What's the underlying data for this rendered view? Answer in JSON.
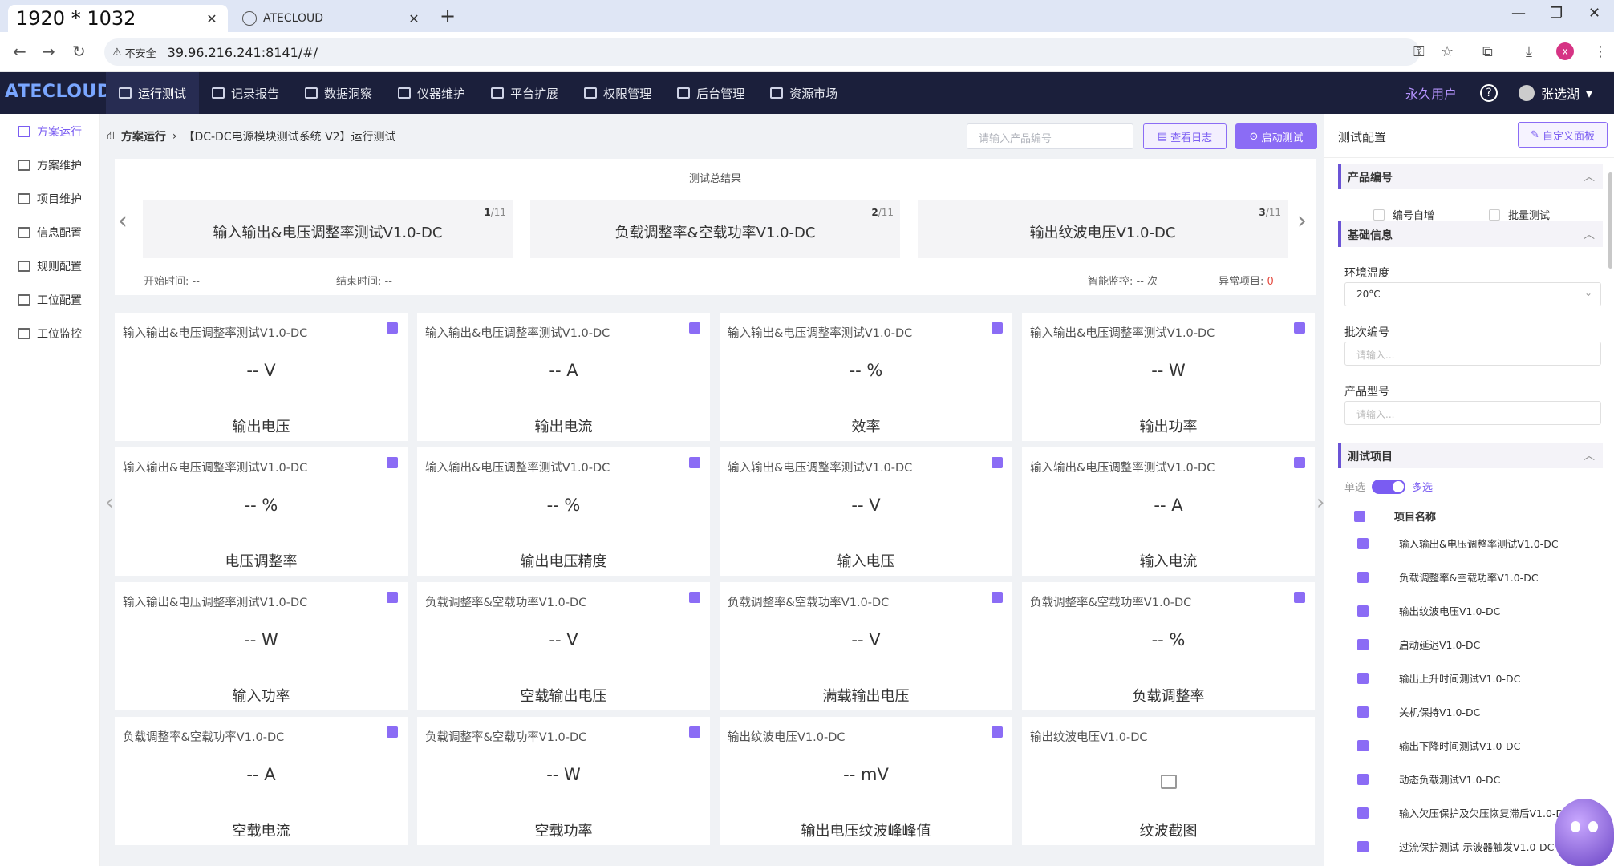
{
  "browser": {
    "active_tab_title": "1920 * 1032",
    "inactive_tab_title": "ATECLOUD",
    "insecure_label": "不安全",
    "url": "39.96.216.241:8141/#/"
  },
  "app": {
    "logo": "ATECLOUD",
    "nav": [
      "运行测试",
      "记录报告",
      "数据洞察",
      "仪器维护",
      "平台扩展",
      "权限管理",
      "后台管理",
      "资源市场"
    ],
    "vip_label": "永久用户",
    "user_name": "张选湖"
  },
  "sidebar": {
    "items": [
      "方案运行",
      "方案维护",
      "项目维护",
      "信息配置",
      "规则配置",
      "工位配置",
      "工位监控"
    ]
  },
  "main": {
    "breadcrumb_root": "方案运行",
    "breadcrumb_page": "【DC-DC电源模块测试系统 V2】运行测试",
    "search_placeholder": "请输入产品编号",
    "view_log_label": "查看日志",
    "start_test_label": "启动测试",
    "summary_title": "测试总结果",
    "carousel": [
      {
        "name": "输入输出&电压调整率测试V1.0-DC",
        "index": "1",
        "total": "/11"
      },
      {
        "name": "负载调整率&空载功率V1.0-DC",
        "index": "2",
        "total": "/11"
      },
      {
        "name": "输出纹波电压V1.0-DC",
        "index": "3",
        "total": "/11"
      }
    ],
    "start_time_label": "开始时间:",
    "start_time_value": "--",
    "end_time_label": "结束时间:",
    "end_time_value": "--",
    "monitor_label": "智能监控:",
    "monitor_value": "-- 次",
    "abnormal_label": "异常项目:",
    "abnormal_value": "0",
    "cards": [
      {
        "title": "输入输出&电压调整率测试V1.0-DC",
        "value": "-- V",
        "label": "输出电压",
        "checked": true
      },
      {
        "title": "输入输出&电压调整率测试V1.0-DC",
        "value": "-- A",
        "label": "输出电流",
        "checked": true
      },
      {
        "title": "输入输出&电压调整率测试V1.0-DC",
        "value": "-- %",
        "label": "效率",
        "checked": true
      },
      {
        "title": "输入输出&电压调整率测试V1.0-DC",
        "value": "-- W",
        "label": "输出功率",
        "checked": true
      },
      {
        "title": "输入输出&电压调整率测试V1.0-DC",
        "value": "-- %",
        "label": "电压调整率",
        "checked": true
      },
      {
        "title": "输入输出&电压调整率测试V1.0-DC",
        "value": "-- %",
        "label": "输出电压精度",
        "checked": true
      },
      {
        "title": "输入输出&电压调整率测试V1.0-DC",
        "value": "-- V",
        "label": "输入电压",
        "checked": true
      },
      {
        "title": "输入输出&电压调整率测试V1.0-DC",
        "value": "-- A",
        "label": "输入电流",
        "checked": true
      },
      {
        "title": "输入输出&电压调整率测试V1.0-DC",
        "value": "-- W",
        "label": "输入功率",
        "checked": true
      },
      {
        "title": "负载调整率&空载功率V1.0-DC",
        "value": "-- V",
        "label": "空载输出电压",
        "checked": true
      },
      {
        "title": "负载调整率&空载功率V1.0-DC",
        "value": "-- V",
        "label": "满载输出电压",
        "checked": true
      },
      {
        "title": "负载调整率&空载功率V1.0-DC",
        "value": "-- %",
        "label": "负载调整率",
        "checked": true
      },
      {
        "title": "负载调整率&空载功率V1.0-DC",
        "value": "-- A",
        "label": "空载电流",
        "checked": true
      },
      {
        "title": "负载调整率&空载功率V1.0-DC",
        "value": "-- W",
        "label": "空载功率",
        "checked": true
      },
      {
        "title": "输出纹波电压V1.0-DC",
        "value": "-- mV",
        "label": "输出电压纹波峰峰值",
        "checked": true
      },
      {
        "title": "输出纹波电压V1.0-DC",
        "value": "",
        "label": "纹波截图",
        "checked": false
      }
    ]
  },
  "right_panel": {
    "title": "测试配置",
    "custom_panel_label": "自定义面板",
    "sections": {
      "product_no": "产品编号",
      "basic_info": "基础信息",
      "test_items": "测试项目"
    },
    "auto_increment_label": "编号自增",
    "batch_test_label": "批量测试",
    "env_temp_label": "环境温度",
    "env_temp_value": "20°C",
    "batch_no_label": "批次编号",
    "batch_no_placeholder": "请输入...",
    "product_model_label": "产品型号",
    "product_model_placeholder": "请输入...",
    "single_label": "单选",
    "multi_label": "多选",
    "project_name_header": "项目名称",
    "projects": [
      "输入输出&电压调整率测试V1.0-DC",
      "负载调整率&空载功率V1.0-DC",
      "输出纹波电压V1.0-DC",
      "启动延迟V1.0-DC",
      "输出上升时间测试V1.0-DC",
      "关机保持V1.0-DC",
      "输出下降时间测试V1.0-DC",
      "动态负载测试V1.0-DC",
      "输入欠压保护及欠压恢复滞后V1.0-DC",
      "过流保护测试-示波器触发V1.0-DC"
    ]
  }
}
